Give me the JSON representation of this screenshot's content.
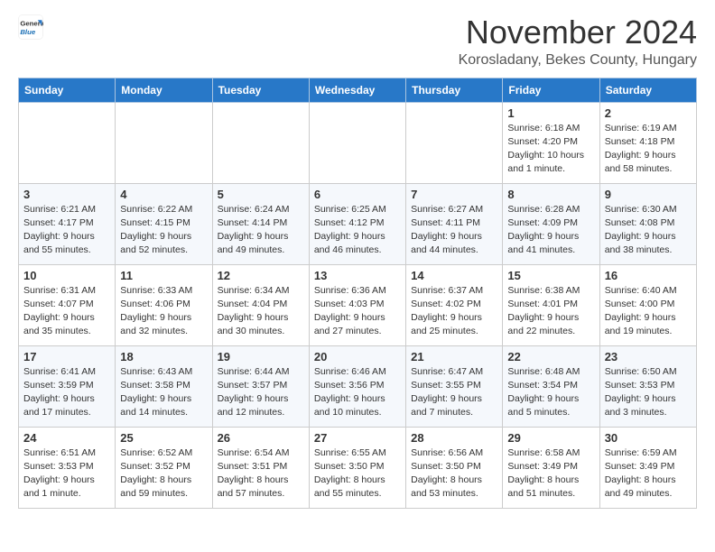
{
  "header": {
    "logo_line1": "General",
    "logo_line2": "Blue",
    "month_title": "November 2024",
    "location": "Korosladany, Bekes County, Hungary"
  },
  "weekdays": [
    "Sunday",
    "Monday",
    "Tuesday",
    "Wednesday",
    "Thursday",
    "Friday",
    "Saturday"
  ],
  "weeks": [
    [
      {
        "day": "",
        "info": ""
      },
      {
        "day": "",
        "info": ""
      },
      {
        "day": "",
        "info": ""
      },
      {
        "day": "",
        "info": ""
      },
      {
        "day": "",
        "info": ""
      },
      {
        "day": "1",
        "info": "Sunrise: 6:18 AM\nSunset: 4:20 PM\nDaylight: 10 hours\nand 1 minute."
      },
      {
        "day": "2",
        "info": "Sunrise: 6:19 AM\nSunset: 4:18 PM\nDaylight: 9 hours\nand 58 minutes."
      }
    ],
    [
      {
        "day": "3",
        "info": "Sunrise: 6:21 AM\nSunset: 4:17 PM\nDaylight: 9 hours\nand 55 minutes."
      },
      {
        "day": "4",
        "info": "Sunrise: 6:22 AM\nSunset: 4:15 PM\nDaylight: 9 hours\nand 52 minutes."
      },
      {
        "day": "5",
        "info": "Sunrise: 6:24 AM\nSunset: 4:14 PM\nDaylight: 9 hours\nand 49 minutes."
      },
      {
        "day": "6",
        "info": "Sunrise: 6:25 AM\nSunset: 4:12 PM\nDaylight: 9 hours\nand 46 minutes."
      },
      {
        "day": "7",
        "info": "Sunrise: 6:27 AM\nSunset: 4:11 PM\nDaylight: 9 hours\nand 44 minutes."
      },
      {
        "day": "8",
        "info": "Sunrise: 6:28 AM\nSunset: 4:09 PM\nDaylight: 9 hours\nand 41 minutes."
      },
      {
        "day": "9",
        "info": "Sunrise: 6:30 AM\nSunset: 4:08 PM\nDaylight: 9 hours\nand 38 minutes."
      }
    ],
    [
      {
        "day": "10",
        "info": "Sunrise: 6:31 AM\nSunset: 4:07 PM\nDaylight: 9 hours\nand 35 minutes."
      },
      {
        "day": "11",
        "info": "Sunrise: 6:33 AM\nSunset: 4:06 PM\nDaylight: 9 hours\nand 32 minutes."
      },
      {
        "day": "12",
        "info": "Sunrise: 6:34 AM\nSunset: 4:04 PM\nDaylight: 9 hours\nand 30 minutes."
      },
      {
        "day": "13",
        "info": "Sunrise: 6:36 AM\nSunset: 4:03 PM\nDaylight: 9 hours\nand 27 minutes."
      },
      {
        "day": "14",
        "info": "Sunrise: 6:37 AM\nSunset: 4:02 PM\nDaylight: 9 hours\nand 25 minutes."
      },
      {
        "day": "15",
        "info": "Sunrise: 6:38 AM\nSunset: 4:01 PM\nDaylight: 9 hours\nand 22 minutes."
      },
      {
        "day": "16",
        "info": "Sunrise: 6:40 AM\nSunset: 4:00 PM\nDaylight: 9 hours\nand 19 minutes."
      }
    ],
    [
      {
        "day": "17",
        "info": "Sunrise: 6:41 AM\nSunset: 3:59 PM\nDaylight: 9 hours\nand 17 minutes."
      },
      {
        "day": "18",
        "info": "Sunrise: 6:43 AM\nSunset: 3:58 PM\nDaylight: 9 hours\nand 14 minutes."
      },
      {
        "day": "19",
        "info": "Sunrise: 6:44 AM\nSunset: 3:57 PM\nDaylight: 9 hours\nand 12 minutes."
      },
      {
        "day": "20",
        "info": "Sunrise: 6:46 AM\nSunset: 3:56 PM\nDaylight: 9 hours\nand 10 minutes."
      },
      {
        "day": "21",
        "info": "Sunrise: 6:47 AM\nSunset: 3:55 PM\nDaylight: 9 hours\nand 7 minutes."
      },
      {
        "day": "22",
        "info": "Sunrise: 6:48 AM\nSunset: 3:54 PM\nDaylight: 9 hours\nand 5 minutes."
      },
      {
        "day": "23",
        "info": "Sunrise: 6:50 AM\nSunset: 3:53 PM\nDaylight: 9 hours\nand 3 minutes."
      }
    ],
    [
      {
        "day": "24",
        "info": "Sunrise: 6:51 AM\nSunset: 3:53 PM\nDaylight: 9 hours\nand 1 minute."
      },
      {
        "day": "25",
        "info": "Sunrise: 6:52 AM\nSunset: 3:52 PM\nDaylight: 8 hours\nand 59 minutes."
      },
      {
        "day": "26",
        "info": "Sunrise: 6:54 AM\nSunset: 3:51 PM\nDaylight: 8 hours\nand 57 minutes."
      },
      {
        "day": "27",
        "info": "Sunrise: 6:55 AM\nSunset: 3:50 PM\nDaylight: 8 hours\nand 55 minutes."
      },
      {
        "day": "28",
        "info": "Sunrise: 6:56 AM\nSunset: 3:50 PM\nDaylight: 8 hours\nand 53 minutes."
      },
      {
        "day": "29",
        "info": "Sunrise: 6:58 AM\nSunset: 3:49 PM\nDaylight: 8 hours\nand 51 minutes."
      },
      {
        "day": "30",
        "info": "Sunrise: 6:59 AM\nSunset: 3:49 PM\nDaylight: 8 hours\nand 49 minutes."
      }
    ]
  ]
}
